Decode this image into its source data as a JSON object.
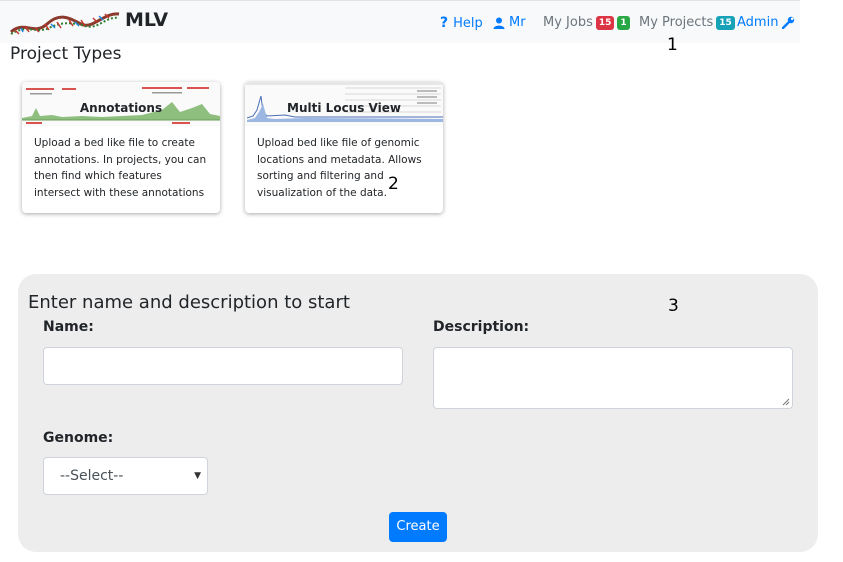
{
  "navbar": {
    "brand": "MLV",
    "help": "Help",
    "user": "Mr",
    "my_jobs": "My Jobs",
    "jobs_badge_red": "15",
    "jobs_badge_green": "1",
    "my_projects": "My Projects",
    "projects_badge": "15",
    "admin": "Admin",
    "icons": [
      "question-icon",
      "user-icon",
      "wrench-icon",
      "dna-logo"
    ],
    "colors": {
      "link": "#007bff",
      "muted": "#6c757d",
      "badge_red": "#dc3545",
      "badge_green": "#28a745",
      "badge_teal": "#17a2b8"
    }
  },
  "annotation_markers": {
    "one": "1",
    "two": "2",
    "three": "3"
  },
  "project_types": {
    "title": "Project Types",
    "cards": [
      {
        "title": "Annotations",
        "description": "Upload a bed like file to create annotations. In projects, you can then find which features intersect with these annotations"
      },
      {
        "title": "Multi Locus View",
        "description": "Upload bed like file of genomic locations and metadata. Allows sorting and filtering and visualization of the data."
      }
    ]
  },
  "form": {
    "heading": "Enter name and description to start",
    "name_label": "Name:",
    "name_value": "",
    "description_label": "Description:",
    "description_value": "",
    "genome_label": "Genome:",
    "genome_selected": "--Select--",
    "create_button": "Create",
    "colors": {
      "panel": "#ededed",
      "button": "#007bff"
    }
  }
}
